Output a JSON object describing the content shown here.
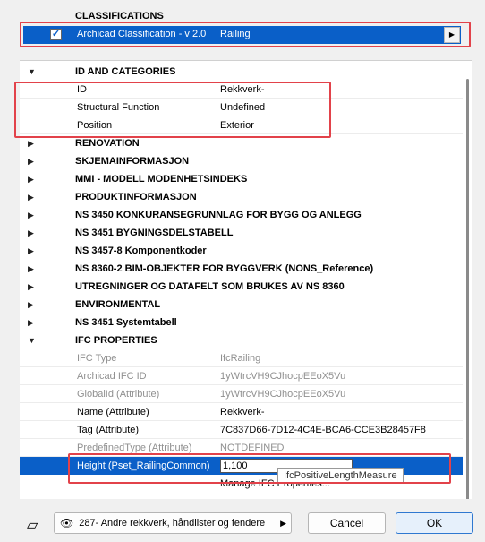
{
  "classifications": {
    "title": "CLASSIFICATIONS",
    "system_name": "Archicad Classification - v 2.0",
    "value": "Railing",
    "checked": true
  },
  "groups": {
    "id_categories": "ID AND CATEGORIES",
    "renovation": "RENOVATION",
    "skjema": "SKJEMAINFORMASJON",
    "mmi": "MMI - MODELL MODENHETSINDEKS",
    "produkt": "PRODUKTINFORMASJON",
    "ns3450": "NS 3450 KONKURANSEGRUNNLAG FOR BYGG OG ANLEGG",
    "ns3451": "NS 3451 BYGNINGSDELSTABELL",
    "ns3457": "NS 3457-8 Komponentkoder",
    "ns8360bim": "NS 8360-2 BIM-OBJEKTER FOR BYGGVERK (NONS_Reference)",
    "utregninger": "UTREGNINGER OG DATAFELT SOM BRUKES AV NS 8360",
    "environmental": "ENVIRONMENTAL",
    "ns3451sys": "NS 3451 Systemtabell",
    "ifc": "IFC PROPERTIES"
  },
  "id_props": [
    {
      "label": "ID",
      "value": "Rekkverk-"
    },
    {
      "label": "Structural Function",
      "value": "Undefined"
    },
    {
      "label": "Position",
      "value": "Exterior"
    }
  ],
  "ifc_props": [
    {
      "label": "IFC Type",
      "value": "IfcRailing"
    },
    {
      "label": "Archicad IFC ID",
      "value": "1yWtrcVH9CJhocpEEoX5Vu"
    },
    {
      "label": "GlobalId (Attribute)",
      "value": "1yWtrcVH9CJhocpEEoX5Vu"
    },
    {
      "label": "Name (Attribute)",
      "value": "Rekkverk-"
    },
    {
      "label": "Tag (Attribute)",
      "value": "7C837D66-7D12-4C4E-BCA6-CCE3B28457F8"
    },
    {
      "label": "PredefinedType (Attribute)",
      "value": "NOTDEFINED"
    },
    {
      "label": "Height (Pset_RailingCommon)",
      "value": "1,100"
    }
  ],
  "tooltip": "IfcPositiveLengthMeasure",
  "manage_link": "Manage IFC Properties...",
  "footer": {
    "layer": "287- Andre rekkverk, håndlister og fendere",
    "cancel": "Cancel",
    "ok": "OK"
  },
  "colors": {
    "selection": "#0a5fc8",
    "highlight": "#e2424a"
  }
}
